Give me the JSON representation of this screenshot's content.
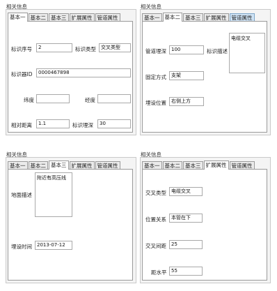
{
  "panels": [
    {
      "title": "相关信息",
      "tabs": [
        "基本一",
        "基本二",
        "基本三",
        "扩展属性",
        "管道属性"
      ],
      "fields": {
        "biaoshi_xuhao_label": "标识序号",
        "biaoshi_xuhao_value": "2",
        "biaoshi_leixing_label": "标识类型",
        "biaoshi_leixing_value": "交叉类型",
        "biaoshiqi_id_label": "标识器ID",
        "biaoshiqi_id_value": "0000467898",
        "weidu_label": "纬度",
        "weidu_value": "",
        "jingdu_label": "经度",
        "jingdu_value": "",
        "xiangdui_juli_label": "相对距离",
        "xiangdui_juli_value": "1.1",
        "biaoshi_licheng_label": "标识埋深",
        "biaoshi_licheng_value": "30"
      }
    },
    {
      "title": "相关信息",
      "tabs": [
        "基本一",
        "基本二",
        "基本三",
        "扩展属性",
        "管道属性"
      ],
      "fields": {
        "guandao_licheng_label": "管道埋深",
        "guandao_licheng_value": "100",
        "biaoshi_miaoshu_label": "标识描述",
        "biaoshi_miaoshu_value": "电缆交叉",
        "guding_fangshi_label": "固定方式",
        "guding_fangshi_value": "支架",
        "maishe_weizhi_label": "埋设位置",
        "maishe_weizhi_value": "右侧上方"
      }
    },
    {
      "title": "相关信息",
      "tabs": [
        "基本一",
        "基本二",
        "基本三",
        "扩展属性",
        "管道属性"
      ],
      "fields": {
        "dimian_miaoshu_label": "地面描述",
        "dimian_miaoshu_value": "附近有高压线",
        "maishe_shijian_label": "埋设时间",
        "maishe_shijian_value": "2013-07-12"
      }
    },
    {
      "title": "相关信息",
      "tabs": [
        "基本一",
        "基本二",
        "基本三",
        "扩展属性",
        "管道属性"
      ],
      "fields": {
        "jiaocha_leixing_label": "交叉类型",
        "jiaocha_leixing_value": "电缆交叉",
        "weizhi_guanxi_label": "位置关系",
        "weizhi_guanxi_value": "本管在下",
        "jiaocha_jianju_label": "交叉间距",
        "jiaocha_jianju_value": "25",
        "jiaoshuiping_label": "距水平",
        "jiaoshuiping_value": "55"
      }
    }
  ]
}
